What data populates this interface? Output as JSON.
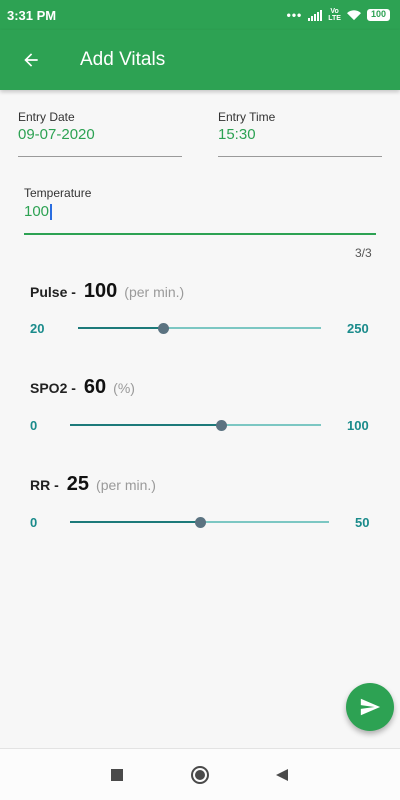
{
  "status_bar": {
    "time": "3:31 PM",
    "network": "Vo LTE",
    "battery": "100",
    "icons": [
      "dots-icon",
      "signal-icon",
      "volte-icon",
      "wifi-icon",
      "battery-icon"
    ]
  },
  "app_bar": {
    "title": "Add Vitals",
    "back_icon": "arrow-left-icon"
  },
  "form": {
    "entry_date": {
      "label": "Entry Date",
      "value": "09-07-2020"
    },
    "entry_time": {
      "label": "Entry Time",
      "value": "15:30"
    },
    "temperature": {
      "label": "Temperature",
      "value": "100",
      "counter": "3/3"
    }
  },
  "vitals": {
    "pulse": {
      "label": "Pulse -",
      "value": "100",
      "unit": "(per min.)",
      "min": "20",
      "max": "250",
      "level": 0.348
    },
    "spo2": {
      "label": "SPO2 -",
      "value": "60",
      "unit": "(%)",
      "min": "0",
      "max": "100",
      "level": 0.6
    },
    "rr": {
      "label": "RR -",
      "value": "25",
      "unit": "(per min.)",
      "min": "0",
      "max": "50",
      "level": 0.5
    }
  },
  "fab": {
    "icon": "send-icon"
  },
  "nav_bar": {
    "icons": [
      "recents-square-icon",
      "home-circle-icon",
      "back-triangle-icon"
    ]
  },
  "colors": {
    "primary": "#2da253",
    "teal_label": "#1a8b8b",
    "slider_active": "#1d7a7a",
    "slider_inactive": "#7cc7c3",
    "thumb": "#5b7381"
  }
}
